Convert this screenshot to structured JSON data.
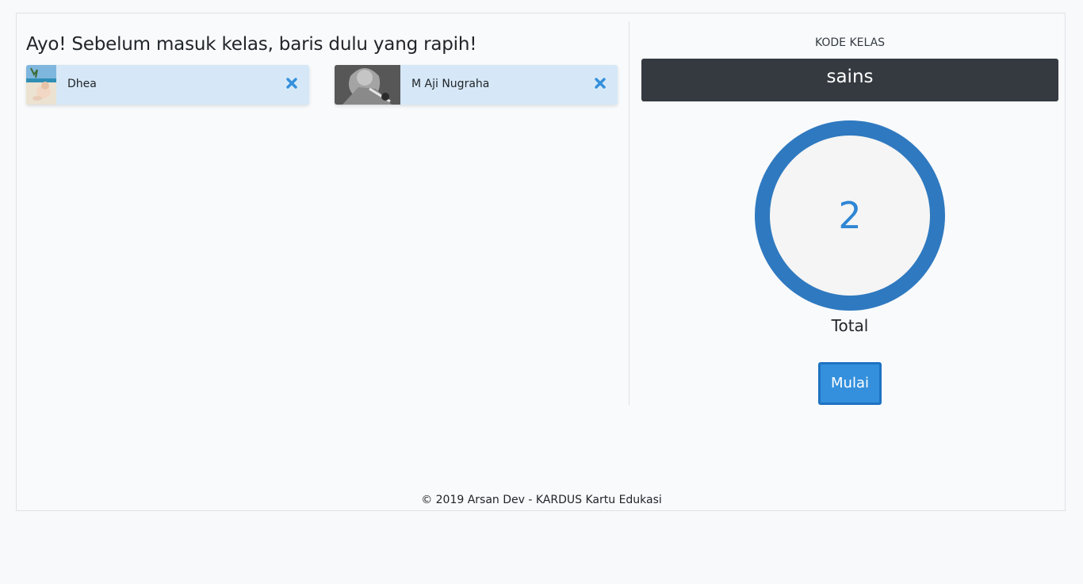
{
  "lobby": {
    "heading": "Ayo! Sebelum masuk kelas, baris dulu yang rapih!",
    "students": [
      {
        "name": "Dhea"
      },
      {
        "name": "M Aji Nugraha"
      }
    ]
  },
  "class_panel": {
    "code_label": "KODE KELAS",
    "code_value": "sains",
    "count": "2",
    "count_label": "Total",
    "start_label": "Mulai"
  },
  "footer": {
    "text": "© 2019 Arsan Dev - KARDUS Kartu Edukasi"
  },
  "colors": {
    "card_bg": "#d6e8f7",
    "accent": "#3490dc",
    "ring": "#2f79c0",
    "code_bg": "#343a40"
  },
  "icons": {
    "remove": "times-icon"
  }
}
